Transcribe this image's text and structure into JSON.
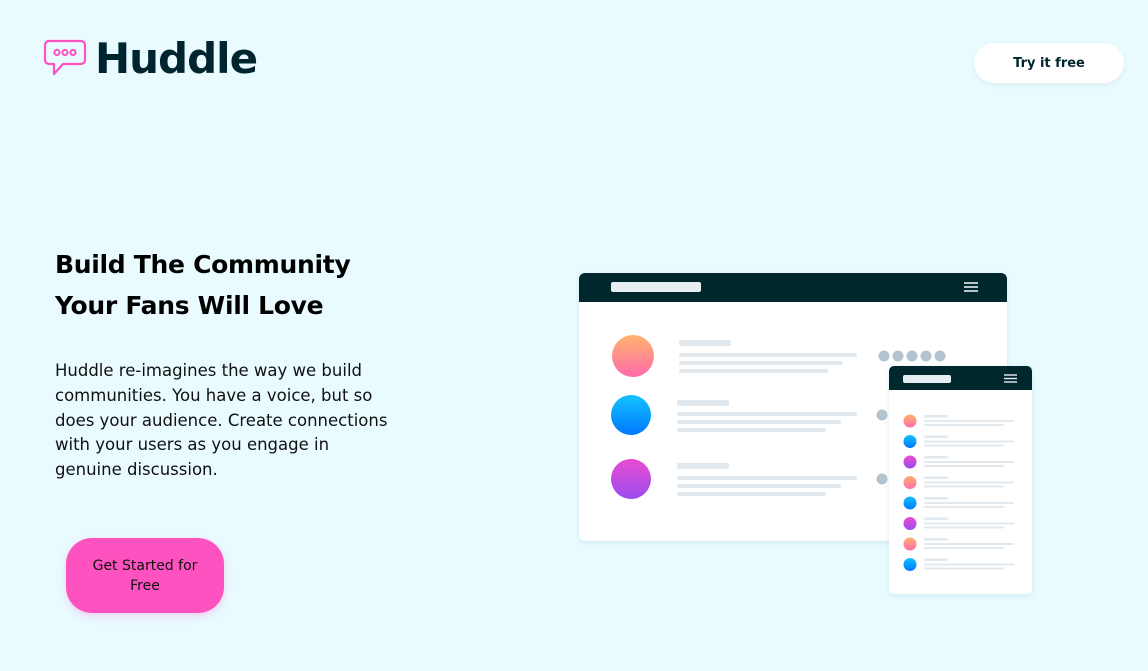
{
  "header": {
    "brand": "Huddle",
    "logo_icon": "chat-bubble-icon",
    "cta_label": "Try it free"
  },
  "hero": {
    "title_line1": "Build The Community",
    "title_line2": "Your Fans Will Love",
    "description": "Huddle re-imagines the way we build communities. You have a voice, but so does your audience. Create connections with your users as you engage in genuine discussion.",
    "cta_label": "Get Started for Free"
  },
  "colors": {
    "background": "#e9fbff",
    "dark": "#00252e",
    "accent_pink": "#ff52c1",
    "logo_pink": "#ff52c1"
  },
  "illustration": {
    "name": "app-mockup-illustration",
    "main_rows": [
      "orange-avatar",
      "blue-avatar",
      "purple-avatar"
    ],
    "side_rows": [
      "orange",
      "blue",
      "purple",
      "orange",
      "blue",
      "purple",
      "orange",
      "blue"
    ]
  }
}
